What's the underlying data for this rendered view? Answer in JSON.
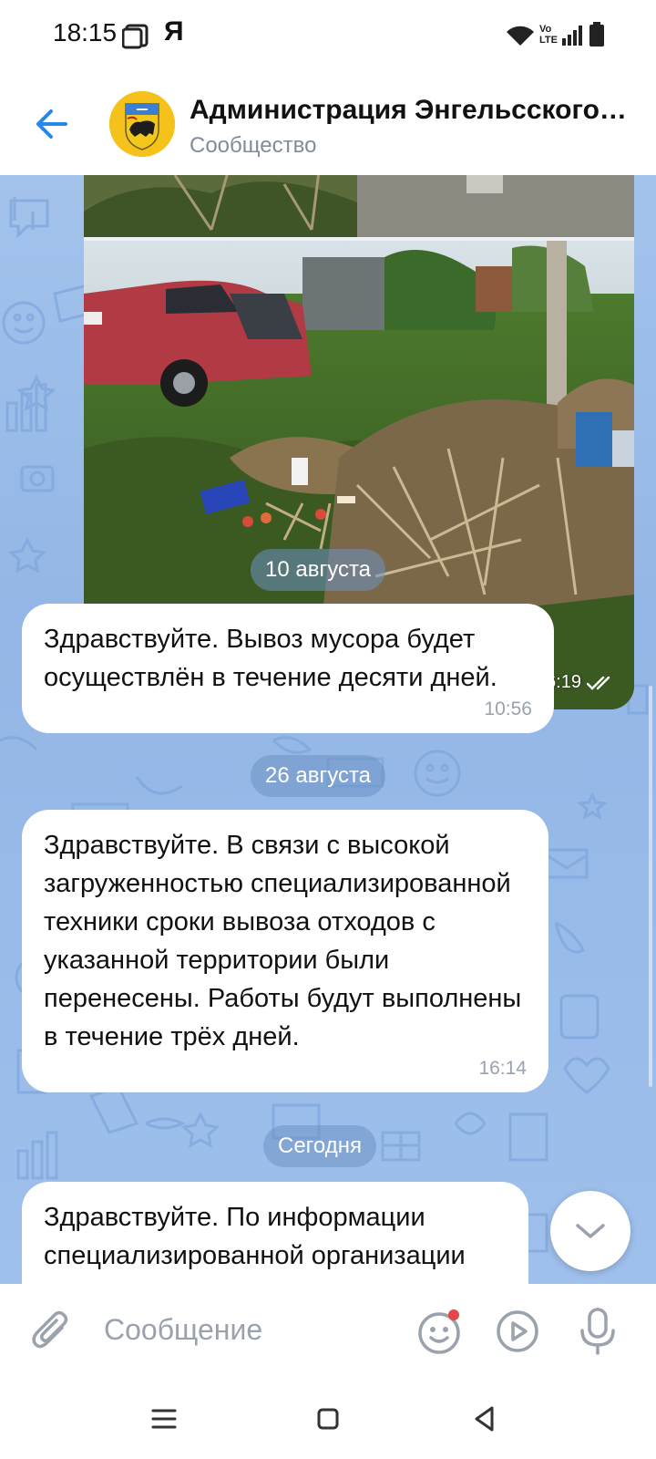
{
  "status_bar": {
    "time": "18:15",
    "carrier_glyph": "Я",
    "icons": [
      "screenshot-icon",
      "wifi-icon",
      "volte-icon",
      "signal-icon",
      "battery-icon"
    ]
  },
  "header": {
    "title": "Администрация Энгельсского…",
    "subtitle": "Сообщество"
  },
  "chat": {
    "photo": {
      "time": "16:19"
    },
    "messages": [
      {
        "date": "10 августа",
        "text": "Здравствуйте. Вывоз мусора будет осуществлён в течение десяти дней.",
        "time": "10:56"
      },
      {
        "date": "26 августа",
        "text": "Здравствуйте. В связи с высокой загруженностью специализированной техники сроки вывоза отходов с указанной территории были перенесены. Работы будут выполнены в течение трёх дней.",
        "time": "16:14"
      },
      {
        "date": "Сегодня",
        "text": "Здравствуйте. По информации специализированной организации",
        "time": ""
      }
    ]
  },
  "input": {
    "placeholder": "Сообщение"
  },
  "colors": {
    "accent": "#2688eb",
    "chat_bg": "#9bbde9",
    "bubble": "#ffffff",
    "muted": "#99a2ad"
  }
}
